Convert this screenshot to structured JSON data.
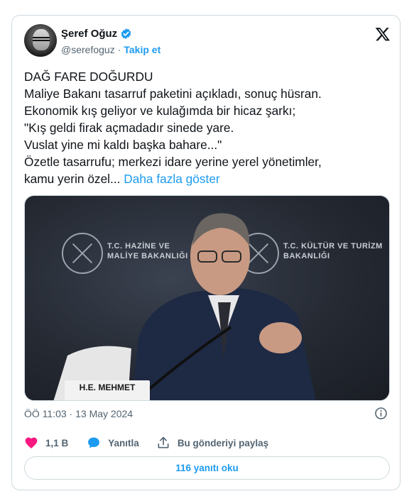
{
  "author": {
    "name": "Şeref Oğuz",
    "handle": "@serefoguz",
    "separator": "·",
    "follow_label": "Takip et"
  },
  "tweet": {
    "text": "DAĞ FARE DOĞURDU\nMaliye Bakanı tasarruf paketini açıkladı, sonuç hüsran.\nEkonomik kış geliyor ve kulağımda bir hicaz şarkı;\n\"Kış geldi firak açmadadır sinede yare.\nVuslat yine mi kaldı başka bahare...\"\nÖzetle tasarrufu; merkezi idare yerine yerel yönetimler,\nkamu yerin özel... ",
    "show_more": "Daha fazla göster"
  },
  "media": {
    "backdrop_left": "T.C. HAZİNE VE\nMALİYE BAKANLIĞI",
    "backdrop_right": "T.C. KÜLTÜR VE TURİZM\nBAKANLIĞI",
    "nameplate": "H.E. MEHMET"
  },
  "timestamp": "ÖÖ 11:03 · 13 May 2024",
  "actions": {
    "likes": "1,1 B",
    "reply_label": "Yanıtla",
    "share_label": "Bu gönderiyi paylaş"
  },
  "read_replies_label": "116 yanıtı oku",
  "colors": {
    "accent": "#1d9bf0",
    "like": "#f91880",
    "muted": "#536471",
    "border": "#cfd9de"
  },
  "icons": [
    "verified-badge-icon",
    "x-logo-icon",
    "info-icon",
    "heart-icon",
    "reply-bubble-icon",
    "share-icon"
  ]
}
